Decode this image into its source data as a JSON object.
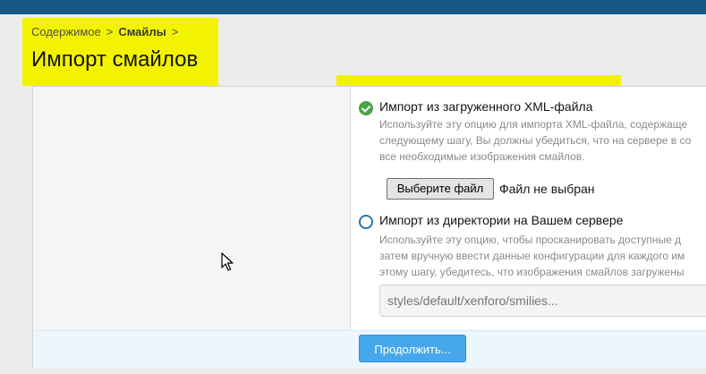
{
  "breadcrumb": {
    "items": [
      "Содержимое",
      "Смайлы"
    ],
    "separator": ">"
  },
  "page_title": "Импорт смайлов",
  "options": [
    {
      "label": "Импорт из загруженного XML-файла",
      "selected": true,
      "description": [
        "Используйте эту опцию для импорта XML-файла, содержаще",
        "следующему шагу, Вы должны убедиться, что на сервере в со",
        "все необходимые изображения смайлов."
      ]
    },
    {
      "label": "Импорт из директории на Вашем сервере",
      "selected": false,
      "description": [
        "Используйте эту опцию, чтобы просканировать доступные д",
        "затем вручную ввести данные конфигурации для каждого им",
        "этому шагу, убедитесь, что изображения смайлов загружены"
      ]
    }
  ],
  "file_input": {
    "button_label": "Выберите файл",
    "status": "Файл не выбран"
  },
  "directory_input": {
    "placeholder": "styles/default/xenforo/smilies..."
  },
  "submit_label": "Продолжить...",
  "colors": {
    "topbar": "#185886",
    "highlight": "#f3f300",
    "radio_selected": "#47a447",
    "radio_unselected": "#2577b1",
    "button_primary": "#47a7eb"
  }
}
